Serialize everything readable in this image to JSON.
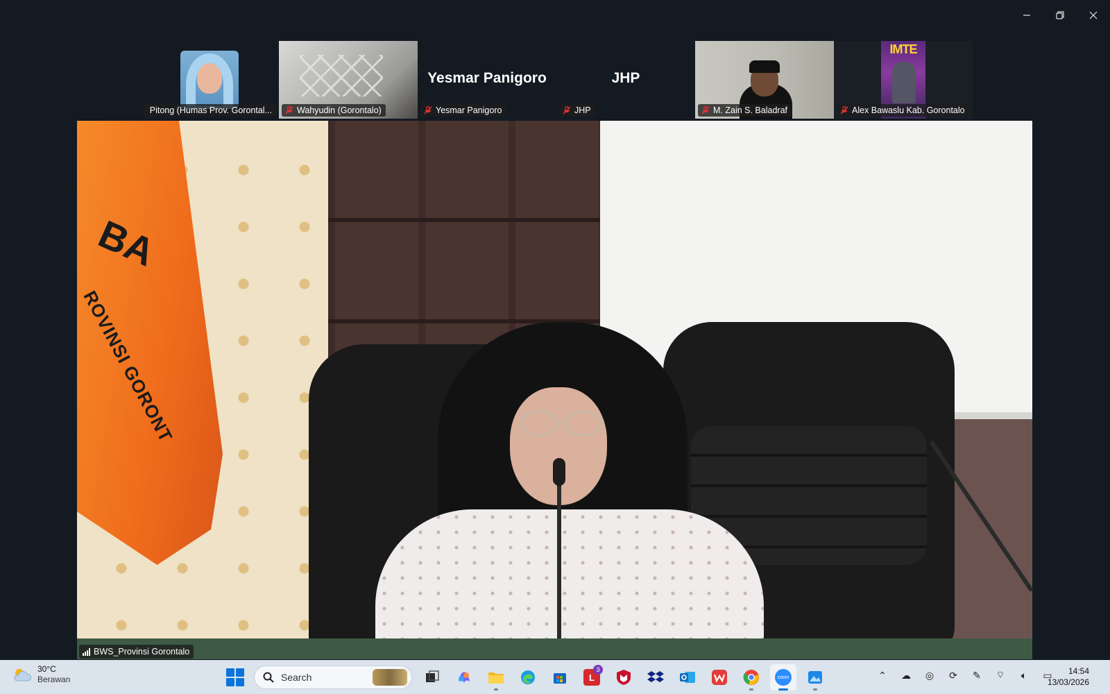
{
  "window": {
    "controls": [
      "minimize",
      "restore",
      "close"
    ]
  },
  "participants": [
    {
      "name": "Pitong (Humas Prov. Gorontal...",
      "kind": "photo-hijab",
      "muted": true
    },
    {
      "name": "Wahyudin (Gorontalo)",
      "kind": "photo-ceiling",
      "muted": true
    },
    {
      "name": "Yesmar Panigoro",
      "display_name": "Yesmar Panigoro",
      "kind": "name-only",
      "muted": true
    },
    {
      "name": "JHP",
      "display_name": "JHP",
      "kind": "name-only",
      "muted": true
    },
    {
      "name": "M. Zain S. Baladraf",
      "kind": "photo-man",
      "muted": true
    },
    {
      "name": "Alex Bawaslu Kab. Gorontalo",
      "kind": "photo-poster",
      "poster_text": "IMTE",
      "muted": true
    }
  ],
  "main_video": {
    "label": "BWS_Provinsi Gorontalo",
    "flag_text": "BA",
    "flag_subtext": "ROVINSI GORONT"
  },
  "taskbar": {
    "weather": {
      "temp": "30°C",
      "desc": "Berawan"
    },
    "search_placeholder": "Search",
    "apps": [
      {
        "name": "task-view",
        "color": "#333333"
      },
      {
        "name": "copilot",
        "color": "#7b61ff"
      },
      {
        "name": "file-explorer",
        "color": "#f2b824"
      },
      {
        "name": "edge",
        "color": "#1b9de2"
      },
      {
        "name": "microsoft-store",
        "color": "#1266c7"
      },
      {
        "name": "app-l",
        "color": "#d62a2a",
        "letter": "L",
        "badge": "3"
      },
      {
        "name": "mcafee",
        "color": "#c8102e"
      },
      {
        "name": "dropbox",
        "color": "#0d2481"
      },
      {
        "name": "outlook",
        "color": "#0f6cbd"
      },
      {
        "name": "wps-office",
        "color": "#e43b3b"
      },
      {
        "name": "chrome",
        "color": "#34a853"
      },
      {
        "name": "zoom",
        "color": "#2d8cff",
        "letter": "zoom"
      },
      {
        "name": "photos",
        "color": "#1e88e5"
      }
    ],
    "clock": {
      "time": "14:54",
      "date": "13/03/2026"
    }
  }
}
